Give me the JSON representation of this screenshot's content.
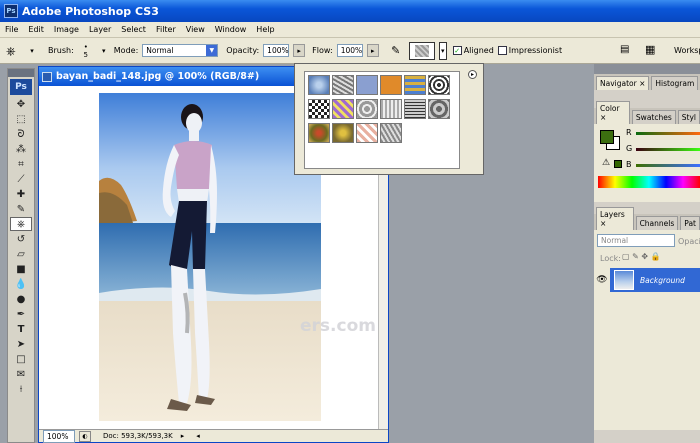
{
  "app": {
    "title": "Adobe Photoshop CS3",
    "icon_text": "Ps"
  },
  "menu": [
    "File",
    "Edit",
    "Image",
    "Layer",
    "Select",
    "Filter",
    "View",
    "Window",
    "Help"
  ],
  "options": {
    "brush_label": "Brush:",
    "brush_size": "5",
    "mode_label": "Mode:",
    "mode_value": "Normal",
    "opacity_label": "Opacity:",
    "opacity_value": "100%",
    "flow_label": "Flow:",
    "flow_value": "100%",
    "aligned_label": "Aligned",
    "aligned_checked": true,
    "impressionist_label": "Impressionist",
    "impressionist_checked": false,
    "workspace_label": "Worksp"
  },
  "toolbox": {
    "logo": "Ps"
  },
  "document": {
    "title": "bayan_badi_148.jpg @ 100% (RGB/8#)",
    "zoom": "100%",
    "doc_size": "Doc: 593,3K/593,3K"
  },
  "watermark": "ers.com",
  "panels": {
    "navigator_tabs": [
      "Navigator",
      "Histogram"
    ],
    "color_tabs": [
      "Color",
      "Swatches",
      "Styl"
    ],
    "color_channels": [
      "R",
      "G",
      "B"
    ],
    "layers_tabs": [
      "Layers",
      "Channels",
      "Pat"
    ],
    "layers_mode": "Normal",
    "layers_opacity_label": "Opacit",
    "lock_label": "Lock:",
    "layer_name": "Background"
  },
  "colors": {
    "accent": "#0a52d4",
    "foreground": "#3c6e10",
    "panel": "#ece9d8"
  }
}
